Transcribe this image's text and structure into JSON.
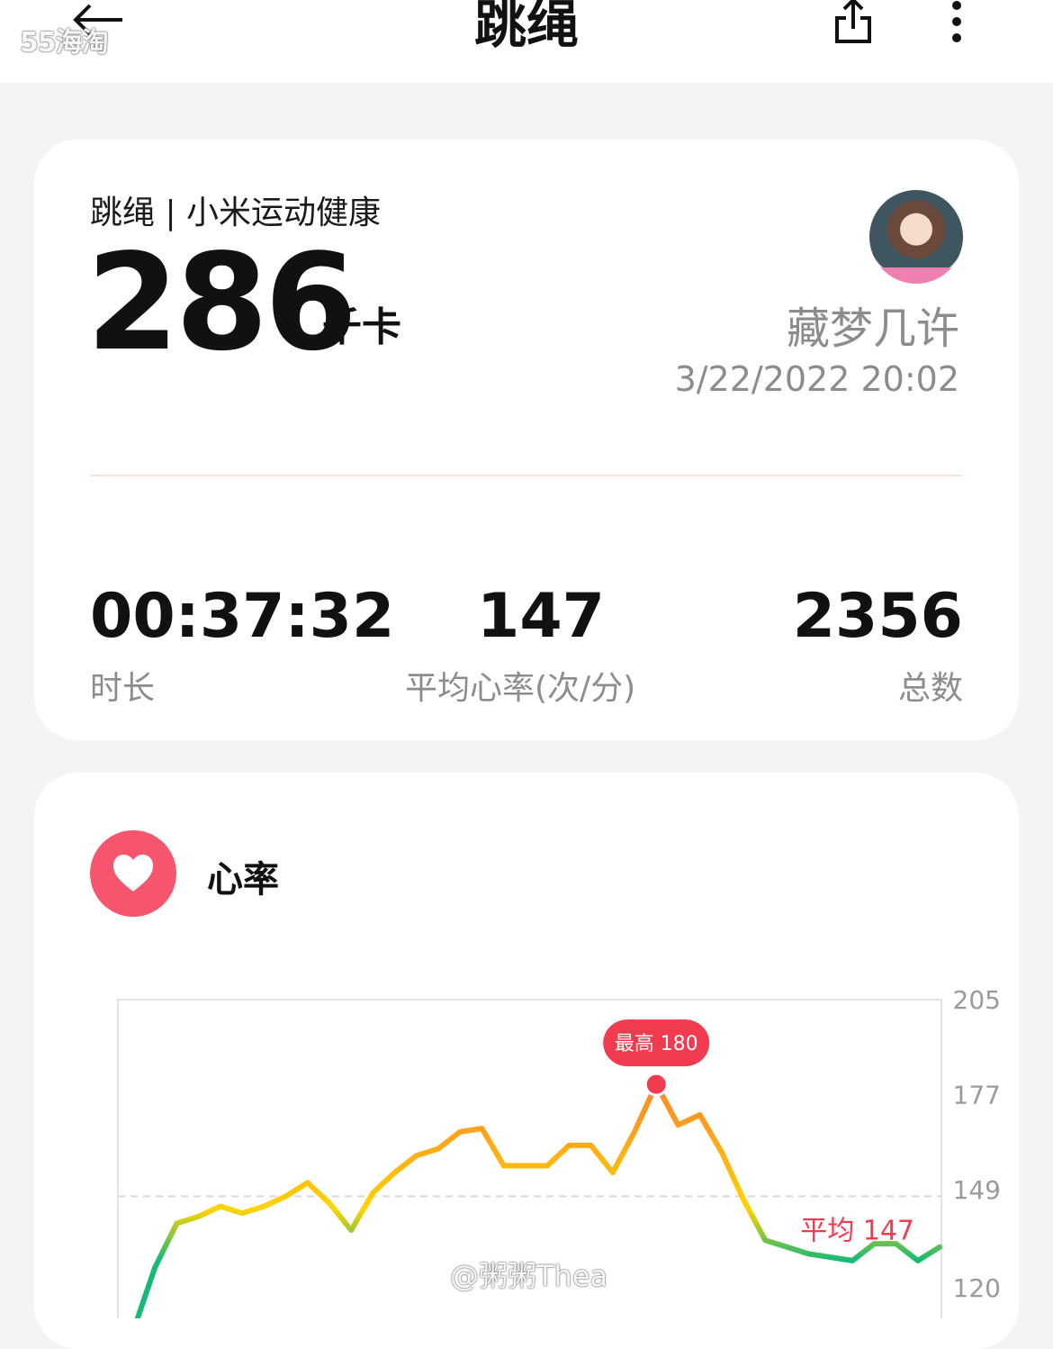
{
  "watermark": {
    "top_left": "55海淘",
    "bottom": "@粥粥Thea"
  },
  "header": {
    "title": "跳绳",
    "back_icon": "arrow-left-icon",
    "share_icon": "share-icon",
    "more_icon": "more-vertical-icon"
  },
  "summary": {
    "source_label": "跳绳 | 小米运动健康",
    "calories": "286",
    "calories_unit": "千卡",
    "username": "藏梦几许",
    "datetime": "3/22/2022 20:02",
    "stats": [
      {
        "value": "00:37:32",
        "label": "时长"
      },
      {
        "value": "147",
        "label": "平均心率(次/分)"
      },
      {
        "value": "2356",
        "label": "总数"
      }
    ]
  },
  "heart_rate": {
    "title": "心率",
    "icon": "heart-icon",
    "accent_color": "#f5566d"
  },
  "chart_data": {
    "type": "line",
    "title": "",
    "xlabel": "",
    "ylabel": "",
    "y_ticks": [
      "205",
      "177",
      "149",
      "120"
    ],
    "ylim": [
      120,
      205
    ],
    "x_unit": "sample index",
    "y": [
      100,
      126,
      139,
      141,
      144,
      142,
      144,
      147,
      151,
      145,
      137,
      148,
      154,
      159,
      161,
      166,
      167,
      156,
      156,
      156,
      162,
      162,
      154,
      166,
      180,
      168,
      171,
      160,
      146,
      134,
      132,
      130,
      129,
      128,
      133,
      133,
      128,
      132
    ],
    "max_label": "最高 180",
    "avg_value": 147,
    "avg_label": "平均 147",
    "colors": {
      "low": "#17b978",
      "mid": "#ffd400",
      "high": "#ff6b2e",
      "marker": "#f23b4f"
    }
  }
}
